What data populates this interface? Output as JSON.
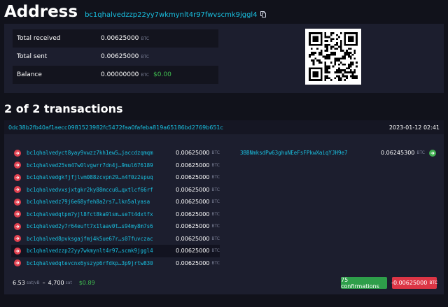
{
  "header": {
    "title": "Address",
    "address": "bc1qhalvedzzp22yy7wkmynlt4r97fwvscmk9jggl4"
  },
  "summary": {
    "rows": [
      {
        "label": "Total received",
        "value": "0.00625000",
        "unit": "BTC",
        "usd": ""
      },
      {
        "label": "Total sent",
        "value": "0.00625000",
        "unit": "BTC",
        "usd": ""
      },
      {
        "label": "Balance",
        "value": "0.00000000",
        "unit": "BTC",
        "usd": "$0.00"
      }
    ]
  },
  "transactions": {
    "heading": "2 of 2 transactions",
    "txid": "0dc38b2fb40af1aecc0981523982fc5472faa0fafeba819a65186bd2769b651c",
    "time": "2023-01-12 02:41",
    "inputs": [
      {
        "address": "bc1qhalvedyct8yay9vwzz7kh1ew5…jaccdzqmqm",
        "amount": "0.00625000",
        "unit": "BTC"
      },
      {
        "address": "bc1qhalved25vm47w0lvgwrr7dn4j…9mul676189",
        "amount": "0.00625000",
        "unit": "BTC"
      },
      {
        "address": "bc1qhalvedgkfjfjlvm088zcvpn29…n4f0z2spuq",
        "amount": "0.00625000",
        "unit": "BTC"
      },
      {
        "address": "bc1qhalvedvxsjxtgkr2ky88mccu0…qxtlcf66rf",
        "amount": "0.00625000",
        "unit": "BTC"
      },
      {
        "address": "bc1qhalvedz79j6e68yfeh8a2rs7…lkn5alyasa",
        "amount": "0.00625000",
        "unit": "BTC"
      },
      {
        "address": "bc1qhalvedqtpm7yjl8fct8ka9lsm…se7t4dxtfx",
        "amount": "0.00625000",
        "unit": "BTC"
      },
      {
        "address": "bc1qhalved2y7r64euft7x1laav0t…s94my8m7s6",
        "amount": "0.00625000",
        "unit": "BTC"
      },
      {
        "address": "bc1qhalved8pvksgajfmj4k5ue67r…s07fuvczac",
        "amount": "0.00625000",
        "unit": "BTC"
      },
      {
        "address": "bc1qhalvedzzp22yy7wkmynlt4r97…scmk9jggl4",
        "amount": "0.00625000",
        "unit": "BTC"
      },
      {
        "address": "bc1qhalvedqtevcnx6yszyp6rfdkp…3p9jrtw830",
        "amount": "0.00625000",
        "unit": "BTC"
      }
    ],
    "outputs": [
      {
        "address": "3BBNmksdPw63ghuNEeFsFPkwXaiqYJH9e7",
        "amount": "0.06245300",
        "unit": "BTC"
      }
    ],
    "fee_rate": "6.53",
    "fee_rate_unit": "sat/vB",
    "fee_separator": "–",
    "fee_sats": "4,700",
    "fee_sats_unit": "sat",
    "fee_usd": "$0.89",
    "confirmations": "75 confirmations",
    "net_amount": "-0.00625000",
    "net_unit": "BTC"
  }
}
